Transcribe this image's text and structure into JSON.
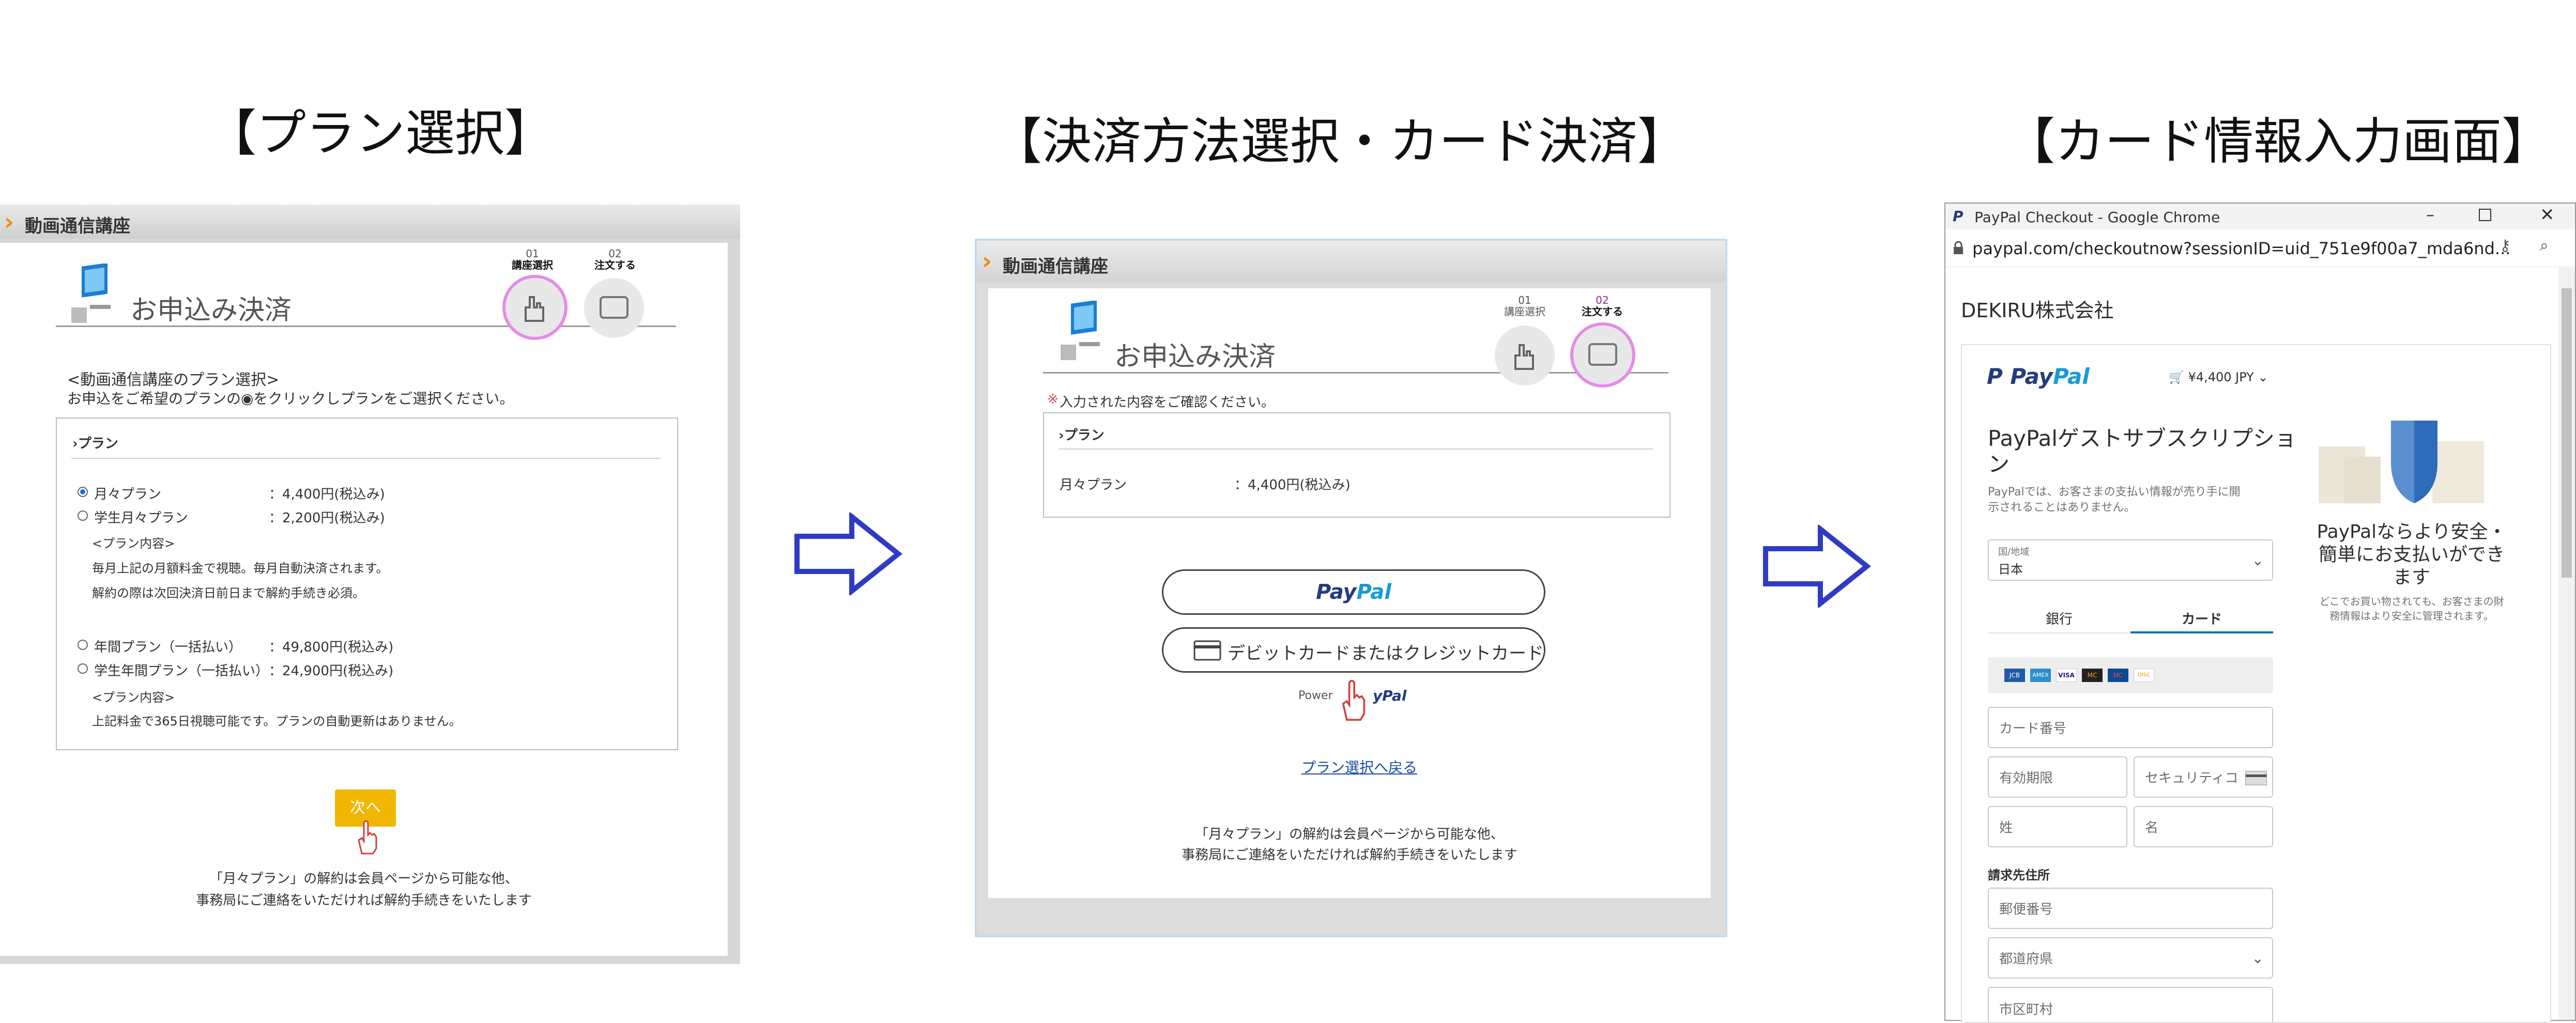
{
  "steps": {
    "step1_title": "【プラン選択】",
    "step2_title": "【決済方法選択・カード決済】",
    "step3_title": "【カード情報入力画面】"
  },
  "panel1": {
    "window_title": "動画通信講座",
    "header_title": "お申込み決済",
    "step1_num": "01",
    "step1_label": "講座選択",
    "step2_num": "02",
    "step2_label": "注文する",
    "intro_heading": "<動画通信講座のプラン選択>",
    "intro_text": "お申込をご希望のプランの◉をクリックしプランをご選択ください。",
    "box_title": "›プラン",
    "plans": [
      {
        "name": "月々プラン",
        "price": "：4,400円(税込み)",
        "selected": true
      },
      {
        "name": "学生月々プラン",
        "price": "：2,200円(税込み)",
        "selected": false
      }
    ],
    "monthly_note_title": "<プラン内容>",
    "monthly_note_1": "毎月上記の月額料金で視聴。毎月自動決済されます。",
    "monthly_note_2": "解約の際は次回決済日前日まで解約手続き必須。",
    "plans_yearly": [
      {
        "name": "年間プラン（一括払い）",
        "price": "：49,800円(税込み)",
        "selected": false
      },
      {
        "name": "学生年間プラン（一括払い）",
        "price": "：24,900円(税込み)",
        "selected": false
      }
    ],
    "yearly_note_title": "<プラン内容>",
    "yearly_note_1": "上記料金で365日視聴可能です。プランの自動更新はありません。",
    "next_button": "次へ",
    "footer_1": "「月々プラン」の解約は会員ページから可能な他、",
    "footer_2": "事務局にご連絡をいただければ解約手続きをいたします"
  },
  "panel2": {
    "window_title": "動画通信講座",
    "header_title": "お申込み決済",
    "step1_num": "01",
    "step1_label": "講座選択",
    "step2_num": "02",
    "step2_label": "注文する",
    "confirm_mark": "※",
    "confirm_text": "入力された内容をご確認ください。",
    "box_title": "›プラン",
    "plan_name": "月々プラン",
    "plan_price": "：4,400円(税込み)",
    "paypal_pay": "Pay",
    "paypal_pal": "Pal",
    "card_button": "デビットカードまたはクレジットカード",
    "powered_prefix": "Power",
    "powered_suffix": "yPal",
    "back_link": "プラン選択へ戻る",
    "footer_1": "「月々プラン」の解約は会員ページから可能な他、",
    "footer_2": "事務局にご連絡をいただければ解約手続きをいたします"
  },
  "panel3": {
    "window_title": "PayPal Checkout - Google Chrome",
    "url": "paypal.com/checkoutnow?sessionID=uid_751e9f00a7_mda6nd...",
    "merchant": "DEKIRU株式会社",
    "paypal_pay": "Pay",
    "paypal_pal": "Pal",
    "cart_amount": "¥4,400 JPY",
    "heading_line1": "PayPalゲストサブスクリプショ",
    "heading_line2": "ン",
    "desc_line1": "PayPalでは、お客さまの支払い情報が売り手に開",
    "desc_line2": "示されることはありません。",
    "country_label": "国/地域",
    "country_value": "日本",
    "tab_bank": "銀行",
    "tab_card": "カード",
    "card_brands": [
      "JCB",
      "AMEX",
      "VISA",
      "MC",
      "MC",
      "DISC"
    ],
    "field_card_number": "カード番号",
    "field_expiry": "有効期限",
    "field_security": "セキュリティコ",
    "field_last_name": "姓",
    "field_first_name": "名",
    "billing_heading": "請求先住所",
    "field_postal": "郵便番号",
    "field_prefecture": "都道府県",
    "field_city": "市区町村",
    "promo_line1": "PayPalならより安全・",
    "promo_line2": "簡単にお支払いができ",
    "promo_line3": "ます",
    "promo_small1": "どこでお買い物されても、お客さまの財",
    "promo_small2": "務情報はより安全に管理されます。"
  },
  "colors": {
    "accent_orange": "#f08c00",
    "next_button": "#f1b600",
    "step_highlight": "#e58be8",
    "arrow_blue": "#2e3bc4",
    "paypal_dark": "#253b80",
    "paypal_light": "#179bd7"
  },
  "icons": [
    "chevron-right-icon",
    "computer-icon",
    "hand-cursor-icon",
    "arrow-right-icon",
    "card-icon",
    "lock-icon",
    "key-icon",
    "zoom-icon",
    "cart-icon",
    "chevron-down-icon",
    "shield-icon"
  ]
}
